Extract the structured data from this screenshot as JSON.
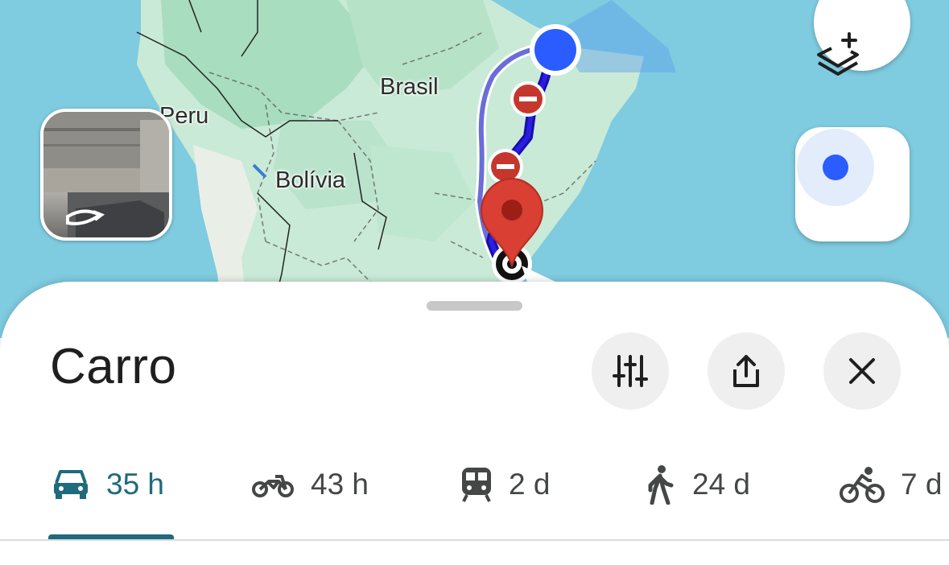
{
  "map": {
    "labels": {
      "brasil": "Brasil",
      "peru": "Peru",
      "bolivia": "Bolívia"
    },
    "colors": {
      "water": "#7fcbe0",
      "land": "#c9ead6",
      "route_primary": "#1a0dab",
      "route_alt": "#6a6ed8",
      "origin": "#2a5cff",
      "destination_pin": "#d93f32",
      "closure": "#c5372c"
    }
  },
  "sheet": {
    "title": "Carro",
    "buttons": {
      "options": "options",
      "share": "share",
      "close": "close"
    }
  },
  "modes": [
    {
      "icon": "car-icon",
      "value": "35 h",
      "active": true
    },
    {
      "icon": "motorcycle-icon",
      "value": "43 h",
      "active": false
    },
    {
      "icon": "transit-icon",
      "value": "2 d",
      "active": false
    },
    {
      "icon": "walking-icon",
      "value": "24 d",
      "active": false
    },
    {
      "icon": "bicycle-icon",
      "value": "7 d",
      "active": false
    }
  ]
}
